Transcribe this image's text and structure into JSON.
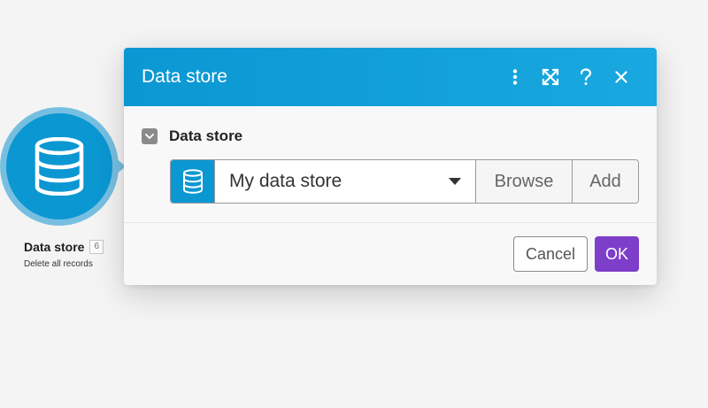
{
  "module": {
    "title": "Data store",
    "badge": "6",
    "subtitle": "Delete all records",
    "icon": "database-icon"
  },
  "dialog": {
    "title": "Data store",
    "header_icons": [
      "more-vertical-icon",
      "expand-icon",
      "help-icon",
      "close-icon"
    ],
    "field": {
      "label": "Data store",
      "value": "My data store",
      "browse_label": "Browse",
      "add_label": "Add"
    },
    "cancel_label": "Cancel",
    "ok_label": "OK"
  },
  "colors": {
    "accent": "#0b97d2",
    "primary_button": "#7d3ec9",
    "halo": "#77bfe1"
  }
}
